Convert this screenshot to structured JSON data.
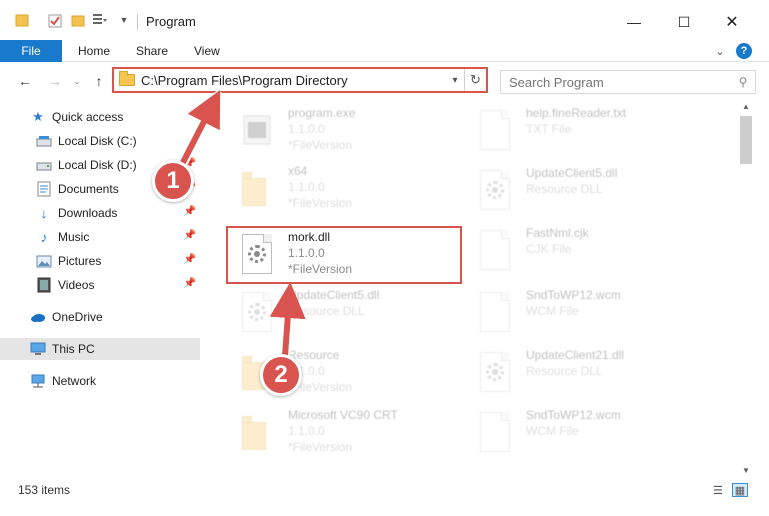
{
  "window": {
    "title": "Program",
    "controls": [
      "minimize",
      "maximize",
      "close"
    ]
  },
  "ribbon": {
    "tabs": [
      "File",
      "Home",
      "Share",
      "View"
    ],
    "expand_icon": "chevron-down",
    "help_icon": "?"
  },
  "nav": {
    "address": "C:\\Program Files\\Program Directory",
    "search_placeholder": "Search Program"
  },
  "sidebar": {
    "items": [
      {
        "label": "Quick access",
        "icon": "star-icon"
      },
      {
        "label": "Local Disk (C:)",
        "icon": "drive-icon"
      },
      {
        "label": "Local Disk (D:)",
        "icon": "drive-icon"
      },
      {
        "label": "Documents",
        "icon": "documents-icon"
      },
      {
        "label": "Downloads",
        "icon": "download-icon"
      },
      {
        "label": "Music",
        "icon": "music-icon"
      },
      {
        "label": "Pictures",
        "icon": "pictures-icon"
      },
      {
        "label": "Videos",
        "icon": "videos-icon"
      },
      {
        "label": "OneDrive",
        "icon": "cloud-icon"
      },
      {
        "label": "This PC",
        "icon": "computer-icon"
      },
      {
        "label": "Network",
        "icon": "network-icon"
      }
    ],
    "selected": "This PC"
  },
  "files": {
    "left": [
      {
        "name": "program.exe",
        "line1": "1.1.0.0",
        "line2": "*FileVersion",
        "type": "exe"
      },
      {
        "name": "x64",
        "line1": "1.1.0.0",
        "line2": "*FileVersion",
        "type": "folder"
      },
      {
        "name": "mork.dll",
        "line1": "1.1.0.0",
        "line2": "*FileVersion",
        "type": "dll"
      },
      {
        "name": "UpdateClient5.dll",
        "line1": "Resource DLL",
        "line2": "",
        "type": "dll"
      },
      {
        "name": "Resource",
        "line1": "1.1.0.0",
        "line2": "*FileVersion",
        "type": "folder"
      },
      {
        "name": "Microsoft VC90 CRT",
        "line1": "1.1.0.0",
        "line2": "*FileVersion",
        "type": "folder"
      }
    ],
    "right": [
      {
        "name": "help.fineReader.txt",
        "line1": "TXT File",
        "type": "txt"
      },
      {
        "name": "UpdateClient5.dll",
        "line1": "Resource DLL",
        "type": "dll"
      },
      {
        "name": "FastNml.cjk",
        "line1": "CJK File",
        "type": "txt"
      },
      {
        "name": "SndToWP12.wcm",
        "line1": "WCM File",
        "type": "txt"
      },
      {
        "name": "UpdateClient21.dll",
        "line1": "Resource DLL",
        "type": "dll"
      },
      {
        "name": "SndToWP12.wcm",
        "line1": "WCM File",
        "type": "txt"
      }
    ]
  },
  "status": {
    "item_count": "153 items"
  },
  "annotations": {
    "step1": "1",
    "step2": "2",
    "color": "#d9534f"
  }
}
